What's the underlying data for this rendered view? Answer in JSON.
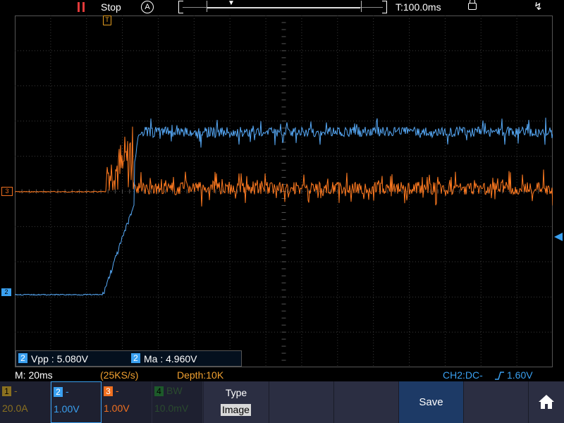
{
  "top_bar": {
    "run_state": "Stop",
    "trigger_mode_icon_text": "A",
    "timebase_position": "T:100.0ms",
    "run_state_color": "#e23a3a",
    "icons": [
      "pause-bars-icon",
      "auto-trigger-icon",
      "lock-icon",
      "usb-icon"
    ]
  },
  "markers": {
    "trigger_marker_text": "T",
    "ch3_marker_text": "3",
    "ch2_marker_text": "2"
  },
  "measurements": [
    {
      "channel": "2",
      "text": "Vpp : 5.080V"
    },
    {
      "channel": "2",
      "text": "Ma : 4.960V"
    }
  ],
  "status": {
    "timebase": "M: 20ms",
    "sample_rate": "(25KS/s)",
    "depth": "Depth:10K",
    "trigger": "CH2:DC-",
    "trigger_level": "1.60V"
  },
  "channels": [
    {
      "number": "1",
      "label": "-",
      "value": "20.0A",
      "color": "#8a7020",
      "active": false
    },
    {
      "number": "2",
      "label": "-",
      "value": "1.00V",
      "color": "#3aa0f0",
      "active": true
    },
    {
      "number": "3",
      "label": "-",
      "value": "1.00V",
      "color": "#f07020",
      "active": false
    },
    {
      "number": "4",
      "label": "BW",
      "value": "10.0mV",
      "color": "#1d5a2a",
      "active": false
    }
  ],
  "menu": {
    "type_label": "Type",
    "type_value": "Image",
    "save_label": "Save"
  },
  "colors": {
    "ch2_trace": "#56a8f5",
    "ch3_trace": "#ff7a20",
    "grid": "#3a3a3a",
    "status_orange": "#f0a030",
    "status_blue": "#3aa0f0"
  }
}
